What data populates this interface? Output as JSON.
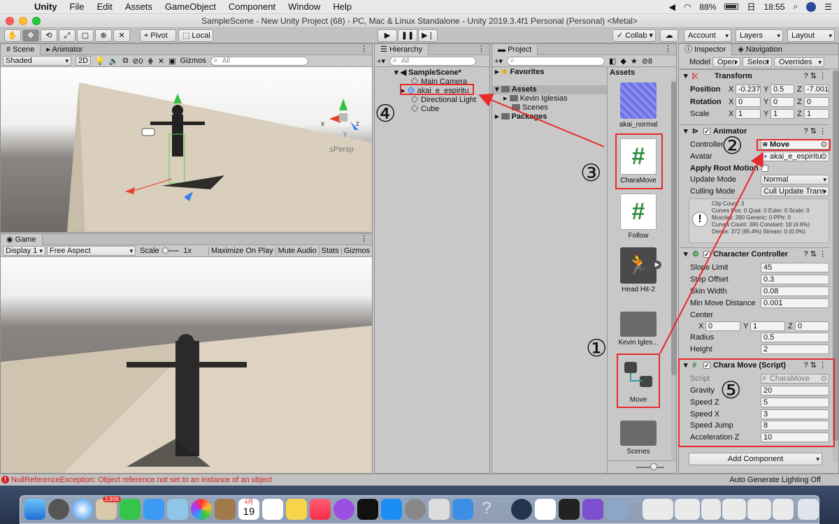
{
  "menubar": {
    "app": "Unity",
    "items": [
      "File",
      "Edit",
      "Assets",
      "GameObject",
      "Component",
      "Window",
      "Help"
    ],
    "battery": "88%",
    "day": "日",
    "time": "18:55"
  },
  "window": {
    "title": "SampleScene - New Unity Project (68) - PC, Mac & Linux Standalone - Unity 2019.3.4f1 Personal (Personal) <Metal>"
  },
  "toolbar": {
    "pivot": "Pivot",
    "local": "Local",
    "collab": "Collab ▾",
    "account": "Account",
    "layers": "Layers",
    "layout": "Layout"
  },
  "scene": {
    "tab": "Scene",
    "tab2": "Animator",
    "shading": "Shaded",
    "mode2d": "2D",
    "hidden_count": "0",
    "gizmos": "Gizmos",
    "search_placeholder": "All",
    "persp": "Persp"
  },
  "game": {
    "tab": "Game",
    "display": "Display 1",
    "aspect": "Free Aspect",
    "scale_label": "Scale",
    "scale_value": "1x",
    "maximize": "Maximize On Play",
    "mute": "Mute Audio",
    "stats": "Stats",
    "gizmos": "Gizmos"
  },
  "hierarchy": {
    "tab": "Hierarchy",
    "search_placeholder": "All",
    "scene": "SampleScene*",
    "items": [
      "Main Camera",
      "akai_e_espiritu",
      "Directional Light",
      "Cube"
    ]
  },
  "project": {
    "tab": "Project",
    "search_placeholder": "",
    "hidden_count": "8",
    "favorites": "Favorites",
    "assets": "Assets",
    "tree": [
      "Kevin Iglesias",
      "Scenes"
    ],
    "packages": "Packages",
    "grid_title": "Assets",
    "grid": [
      "akai_normal",
      "CharaMove",
      "Follow",
      "Head Hit-2",
      "Kevin Igles...",
      "Move",
      "Scenes"
    ]
  },
  "inspector": {
    "tab": "Inspector",
    "tab2": "Navigation",
    "model": "Model",
    "open": "Open",
    "select": "Select",
    "overrides": "Overrides",
    "transform": {
      "title": "Transform",
      "position": "Position",
      "rotation": "Rotation",
      "scale": "Scale",
      "pos": [
        "-0.237",
        "0.5",
        "-7.001"
      ],
      "rot": [
        "0",
        "0",
        "0"
      ],
      "scl": [
        "1",
        "1",
        "1"
      ]
    },
    "animator": {
      "title": "Animator",
      "controller_label": "Controller",
      "controller": "Move",
      "avatar_label": "Avatar",
      "avatar": "akai_e_espiritu",
      "apply_root": "Apply Root Motion",
      "update_label": "Update Mode",
      "update": "Normal",
      "culling_label": "Culling Mode",
      "culling": "Cull Update Trans",
      "info": [
        "Clip Count: 3",
        "Curves Pos: 0 Quat: 0 Euler: 0 Scale: 0",
        "Muscles: 390 Generic: 0 PPtr: 0",
        "Curves Count: 390 Constant: 18 (4.6%)",
        "Dense: 372 (95.4%) Stream: 0 (0.0%)"
      ]
    },
    "cc": {
      "title": "Character Controller",
      "labels": [
        "Slope Limit",
        "Step Offset",
        "Skin Width",
        "Min Move Distance",
        "Center",
        "Radius",
        "Height"
      ],
      "values": [
        "45",
        "0.3",
        "0.08",
        "0.001",
        "",
        "0.5",
        "2"
      ],
      "center": [
        "0",
        "1",
        "0"
      ]
    },
    "script": {
      "title": "Chara Move (Script)",
      "script_label": "Script",
      "script": "CharaMove",
      "labels": [
        "Gravity",
        "Speed Z",
        "Speed X",
        "Speed Jump",
        "Acceleration Z"
      ],
      "values": [
        "20",
        "5",
        "3",
        "8",
        "10"
      ]
    },
    "add_component": "Add Component"
  },
  "status": {
    "error": "NullReferenceException: Object reference not set to an instance of an object",
    "lighting": "Auto Generate Lighting Off"
  },
  "annotations": [
    "①",
    "②",
    "③",
    "④",
    "⑤"
  ],
  "dock": {
    "mail_badge": "2,936",
    "calendar_month": "4月",
    "calendar_day": "19"
  },
  "colors": {
    "annotation_red": "#e82a2a",
    "selection_blue": "#3a72d8",
    "error_red": "#d42020"
  }
}
